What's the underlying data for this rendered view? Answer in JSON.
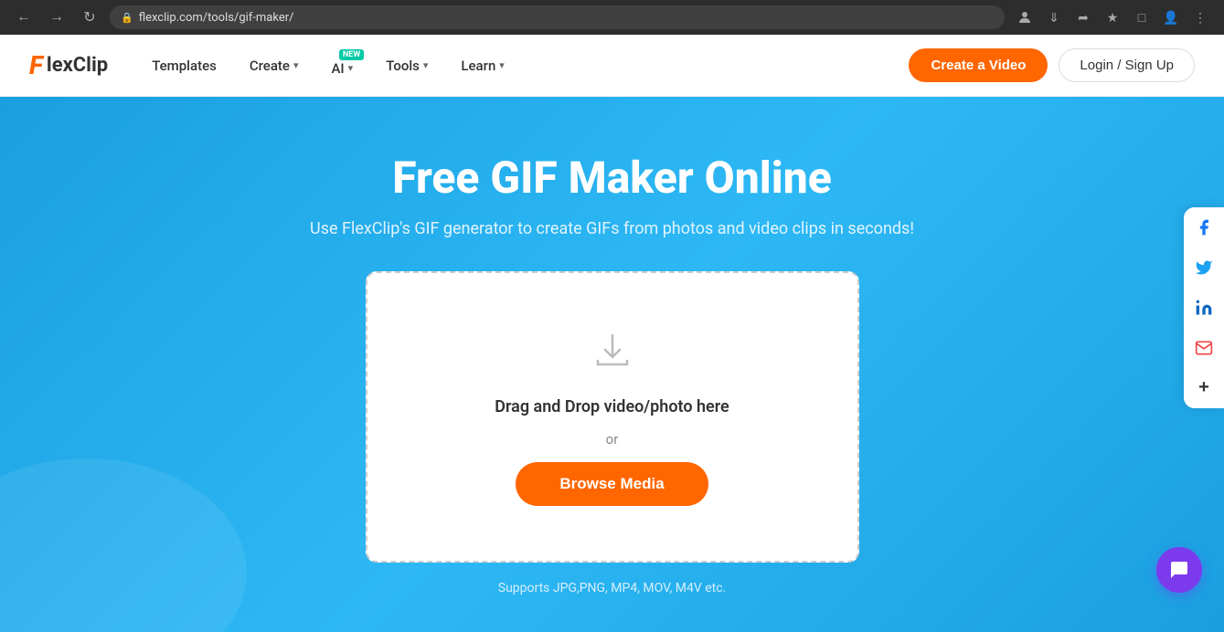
{
  "browser": {
    "url": "flexclip.com/tools/gif-maker/",
    "lock_icon": "🔒"
  },
  "navbar": {
    "logo_f": "F",
    "logo_text": "lexClip",
    "nav_items": [
      {
        "label": "Templates",
        "has_dropdown": false
      },
      {
        "label": "Create",
        "has_dropdown": true
      },
      {
        "label": "AI",
        "has_dropdown": true,
        "badge": "NEW"
      },
      {
        "label": "Tools",
        "has_dropdown": true
      },
      {
        "label": "Learn",
        "has_dropdown": true
      }
    ],
    "create_video_label": "Create a Video",
    "login_label": "Login / Sign Up"
  },
  "hero": {
    "title": "Free GIF Maker Online",
    "subtitle": "Use FlexClip's GIF generator to create GIFs from photos and video clips in seconds!",
    "drag_text": "Drag and Drop video/photo here",
    "or_text": "or",
    "browse_label": "Browse Media",
    "support_text": "Supports JPG,PNG, MP4, MOV, M4V etc."
  },
  "social": {
    "facebook_icon": "f",
    "twitter_icon": "t",
    "linkedin_icon": "in",
    "email_icon": "✉",
    "more_icon": "+"
  }
}
